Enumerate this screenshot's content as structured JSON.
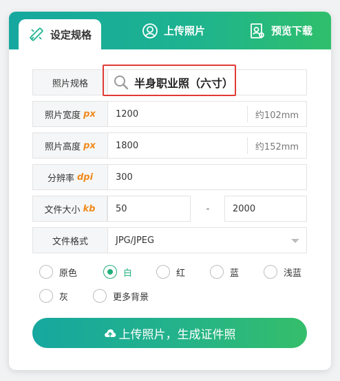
{
  "tabs": [
    {
      "label": "设定规格",
      "icon": "ruler-pencil-icon",
      "active": true
    },
    {
      "label": "上传照片",
      "icon": "user-upload-icon",
      "active": false
    },
    {
      "label": "预览下载",
      "icon": "preview-download-icon",
      "active": false
    }
  ],
  "form": {
    "spec": {
      "label": "照片规格",
      "value": "半身职业照（六寸）",
      "icon": "search-icon"
    },
    "width": {
      "label": "照片宽度",
      "unit": "px",
      "value": "1200",
      "aux": "约102mm"
    },
    "height": {
      "label": "照片高度",
      "unit": "px",
      "value": "1800",
      "aux": "约152mm"
    },
    "resolution": {
      "label": "分辨率",
      "unit": "dpi",
      "value": "300"
    },
    "filesize": {
      "label": "文件大小",
      "unit": "kb",
      "min": "50",
      "separator": "-",
      "max": "2000"
    },
    "format": {
      "label": "文件格式",
      "value": "JPG/JPEG"
    }
  },
  "backgrounds": {
    "selected": "白",
    "options": [
      "原色",
      "白",
      "红",
      "蓝",
      "浅蓝",
      "灰",
      "更多背景"
    ]
  },
  "upload_button": {
    "label": "上传照片，生成证件照",
    "icon": "cloud-upload-icon"
  },
  "colors": {
    "accent": "#1db390",
    "unit_orange": "#f08a1c",
    "highlight_red": "#e03a33"
  }
}
